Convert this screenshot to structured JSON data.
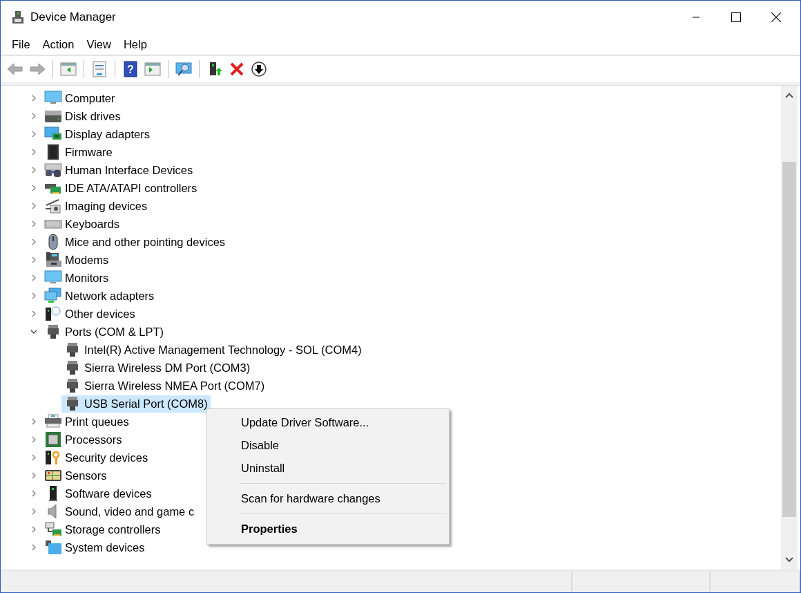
{
  "window": {
    "title": "Device Manager"
  },
  "menu": [
    "File",
    "Action",
    "View",
    "Help"
  ],
  "toolbar": [
    {
      "kind": "back",
      "disabled": true
    },
    {
      "kind": "forward",
      "disabled": true
    },
    {
      "kind": "show-hide",
      "disabled": false
    },
    {
      "kind": "properties",
      "disabled": false
    },
    {
      "kind": "help",
      "disabled": false,
      "label": "?"
    },
    {
      "kind": "view-pane",
      "disabled": false
    },
    {
      "kind": "scan",
      "disabled": false
    },
    {
      "kind": "update",
      "disabled": false
    },
    {
      "kind": "uninstall",
      "disabled": false
    },
    {
      "kind": "download",
      "disabled": false
    }
  ],
  "tree": [
    {
      "label": "Computer",
      "expanded": false,
      "selected": false
    },
    {
      "label": "Disk drives",
      "expanded": false,
      "selected": false
    },
    {
      "label": "Display adapters",
      "expanded": false,
      "selected": false
    },
    {
      "label": "Firmware",
      "expanded": false,
      "selected": false
    },
    {
      "label": "Human Interface Devices",
      "expanded": false,
      "selected": false
    },
    {
      "label": "IDE ATA/ATAPI controllers",
      "expanded": false,
      "selected": false
    },
    {
      "label": "Imaging devices",
      "expanded": false,
      "selected": false
    },
    {
      "label": "Keyboards",
      "expanded": false,
      "selected": false
    },
    {
      "label": "Mice and other pointing devices",
      "expanded": false,
      "selected": false
    },
    {
      "label": "Modems",
      "expanded": false,
      "selected": false
    },
    {
      "label": "Monitors",
      "expanded": false,
      "selected": false
    },
    {
      "label": "Network adapters",
      "expanded": false,
      "selected": false
    },
    {
      "label": "Other devices",
      "expanded": false,
      "selected": false
    },
    {
      "label": "Ports (COM & LPT)",
      "expanded": true,
      "selected": false,
      "children": [
        {
          "label": "Intel(R) Active Management Technology - SOL (COM4)",
          "selected": false
        },
        {
          "label": "Sierra Wireless DM Port (COM3)",
          "selected": false
        },
        {
          "label": "Sierra Wireless NMEA Port (COM7)",
          "selected": false
        },
        {
          "label": "USB Serial Port (COM8)",
          "selected": true
        }
      ]
    },
    {
      "label": "Print queues",
      "expanded": false,
      "selected": false
    },
    {
      "label": "Processors",
      "expanded": false,
      "selected": false
    },
    {
      "label": "Security devices",
      "expanded": false,
      "selected": false
    },
    {
      "label": "Sensors",
      "expanded": false,
      "selected": false
    },
    {
      "label": "Software devices",
      "expanded": false,
      "selected": false
    },
    {
      "label": "Sound, video and game c",
      "expanded": false,
      "selected": false
    },
    {
      "label": "Storage controllers",
      "expanded": false,
      "selected": false
    },
    {
      "label": "System devices",
      "expanded": false,
      "selected": false
    }
  ],
  "context_menu": [
    {
      "label": "Update Driver Software...",
      "default": false,
      "separator_before": false
    },
    {
      "label": "Disable",
      "default": false,
      "separator_before": false
    },
    {
      "label": "Uninstall",
      "default": false,
      "separator_before": false
    },
    {
      "label": "Scan for hardware changes",
      "default": false,
      "separator_before": true
    },
    {
      "label": "Properties",
      "default": true,
      "separator_before": true
    }
  ]
}
